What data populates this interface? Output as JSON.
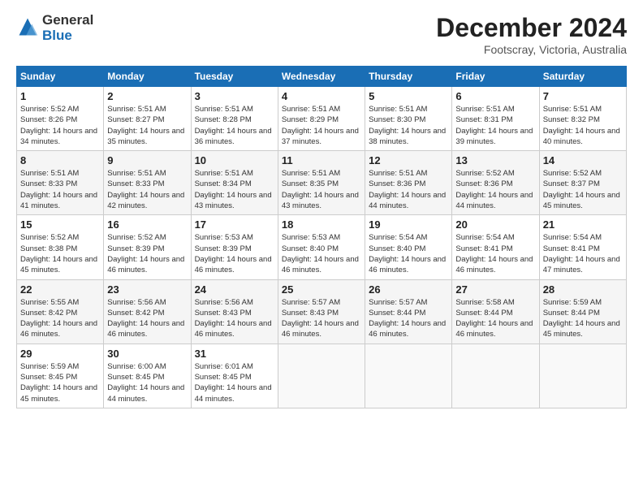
{
  "logo": {
    "general": "General",
    "blue": "Blue"
  },
  "header": {
    "month_year": "December 2024",
    "location": "Footscray, Victoria, Australia"
  },
  "days_of_week": [
    "Sunday",
    "Monday",
    "Tuesday",
    "Wednesday",
    "Thursday",
    "Friday",
    "Saturday"
  ],
  "weeks": [
    [
      {
        "day": "1",
        "sunrise": "5:52 AM",
        "sunset": "8:26 PM",
        "daylight": "14 hours and 34 minutes."
      },
      {
        "day": "2",
        "sunrise": "5:51 AM",
        "sunset": "8:27 PM",
        "daylight": "14 hours and 35 minutes."
      },
      {
        "day": "3",
        "sunrise": "5:51 AM",
        "sunset": "8:28 PM",
        "daylight": "14 hours and 36 minutes."
      },
      {
        "day": "4",
        "sunrise": "5:51 AM",
        "sunset": "8:29 PM",
        "daylight": "14 hours and 37 minutes."
      },
      {
        "day": "5",
        "sunrise": "5:51 AM",
        "sunset": "8:30 PM",
        "daylight": "14 hours and 38 minutes."
      },
      {
        "day": "6",
        "sunrise": "5:51 AM",
        "sunset": "8:31 PM",
        "daylight": "14 hours and 39 minutes."
      },
      {
        "day": "7",
        "sunrise": "5:51 AM",
        "sunset": "8:32 PM",
        "daylight": "14 hours and 40 minutes."
      }
    ],
    [
      {
        "day": "8",
        "sunrise": "5:51 AM",
        "sunset": "8:33 PM",
        "daylight": "14 hours and 41 minutes."
      },
      {
        "day": "9",
        "sunrise": "5:51 AM",
        "sunset": "8:33 PM",
        "daylight": "14 hours and 42 minutes."
      },
      {
        "day": "10",
        "sunrise": "5:51 AM",
        "sunset": "8:34 PM",
        "daylight": "14 hours and 43 minutes."
      },
      {
        "day": "11",
        "sunrise": "5:51 AM",
        "sunset": "8:35 PM",
        "daylight": "14 hours and 43 minutes."
      },
      {
        "day": "12",
        "sunrise": "5:51 AM",
        "sunset": "8:36 PM",
        "daylight": "14 hours and 44 minutes."
      },
      {
        "day": "13",
        "sunrise": "5:52 AM",
        "sunset": "8:36 PM",
        "daylight": "14 hours and 44 minutes."
      },
      {
        "day": "14",
        "sunrise": "5:52 AM",
        "sunset": "8:37 PM",
        "daylight": "14 hours and 45 minutes."
      }
    ],
    [
      {
        "day": "15",
        "sunrise": "5:52 AM",
        "sunset": "8:38 PM",
        "daylight": "14 hours and 45 minutes."
      },
      {
        "day": "16",
        "sunrise": "5:52 AM",
        "sunset": "8:39 PM",
        "daylight": "14 hours and 46 minutes."
      },
      {
        "day": "17",
        "sunrise": "5:53 AM",
        "sunset": "8:39 PM",
        "daylight": "14 hours and 46 minutes."
      },
      {
        "day": "18",
        "sunrise": "5:53 AM",
        "sunset": "8:40 PM",
        "daylight": "14 hours and 46 minutes."
      },
      {
        "day": "19",
        "sunrise": "5:54 AM",
        "sunset": "8:40 PM",
        "daylight": "14 hours and 46 minutes."
      },
      {
        "day": "20",
        "sunrise": "5:54 AM",
        "sunset": "8:41 PM",
        "daylight": "14 hours and 46 minutes."
      },
      {
        "day": "21",
        "sunrise": "5:54 AM",
        "sunset": "8:41 PM",
        "daylight": "14 hours and 47 minutes."
      }
    ],
    [
      {
        "day": "22",
        "sunrise": "5:55 AM",
        "sunset": "8:42 PM",
        "daylight": "14 hours and 46 minutes."
      },
      {
        "day": "23",
        "sunrise": "5:56 AM",
        "sunset": "8:42 PM",
        "daylight": "14 hours and 46 minutes."
      },
      {
        "day": "24",
        "sunrise": "5:56 AM",
        "sunset": "8:43 PM",
        "daylight": "14 hours and 46 minutes."
      },
      {
        "day": "25",
        "sunrise": "5:57 AM",
        "sunset": "8:43 PM",
        "daylight": "14 hours and 46 minutes."
      },
      {
        "day": "26",
        "sunrise": "5:57 AM",
        "sunset": "8:44 PM",
        "daylight": "14 hours and 46 minutes."
      },
      {
        "day": "27",
        "sunrise": "5:58 AM",
        "sunset": "8:44 PM",
        "daylight": "14 hours and 46 minutes."
      },
      {
        "day": "28",
        "sunrise": "5:59 AM",
        "sunset": "8:44 PM",
        "daylight": "14 hours and 45 minutes."
      }
    ],
    [
      {
        "day": "29",
        "sunrise": "5:59 AM",
        "sunset": "8:45 PM",
        "daylight": "14 hours and 45 minutes."
      },
      {
        "day": "30",
        "sunrise": "6:00 AM",
        "sunset": "8:45 PM",
        "daylight": "14 hours and 44 minutes."
      },
      {
        "day": "31",
        "sunrise": "6:01 AM",
        "sunset": "8:45 PM",
        "daylight": "14 hours and 44 minutes."
      },
      null,
      null,
      null,
      null
    ]
  ]
}
